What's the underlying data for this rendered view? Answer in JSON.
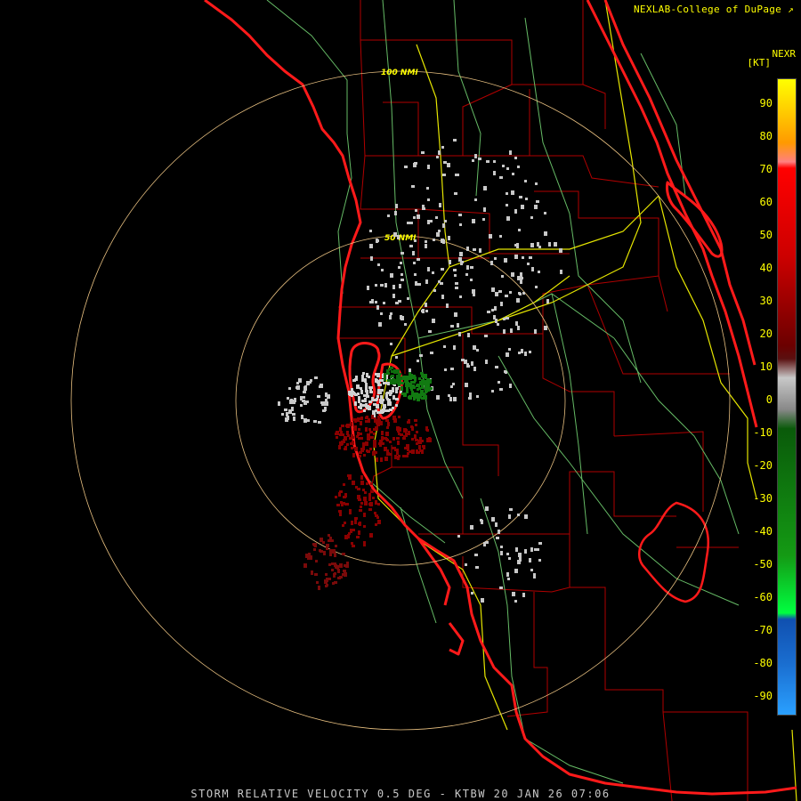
{
  "credit": "NEXLAB-College of DuPage",
  "credit_icon": "external-link-icon",
  "product_code": "NEXR",
  "units": "[KT]",
  "scale_ticks": [
    "90",
    "80",
    "70",
    "60",
    "50",
    "40",
    "30",
    "20",
    "10",
    "0",
    "-10",
    "-20",
    "-30",
    "-40",
    "-50",
    "-60",
    "-70",
    "-80",
    "-90"
  ],
  "scale_colors": {
    "pos_high": "#ffff00",
    "pos_mid": "#ff0000",
    "pos_low": "#6b0000",
    "zero": "#c8c8c8",
    "neg_low": "#0a5a0a",
    "neg_high": "#00ff40",
    "far_neg": "#1560c8"
  },
  "range_rings": [
    {
      "label": "100 NMI"
    },
    {
      "label": "50 NMI"
    }
  ],
  "colors": {
    "coast": "#ff1a1a",
    "county": "#b00000",
    "highway": "#e6e600",
    "road": "#66bb66",
    "ring": "#e8c080"
  },
  "footer": "STORM RELATIVE VELOCITY 0.5 DEG - KTBW 20 JAN 26 07:06"
}
